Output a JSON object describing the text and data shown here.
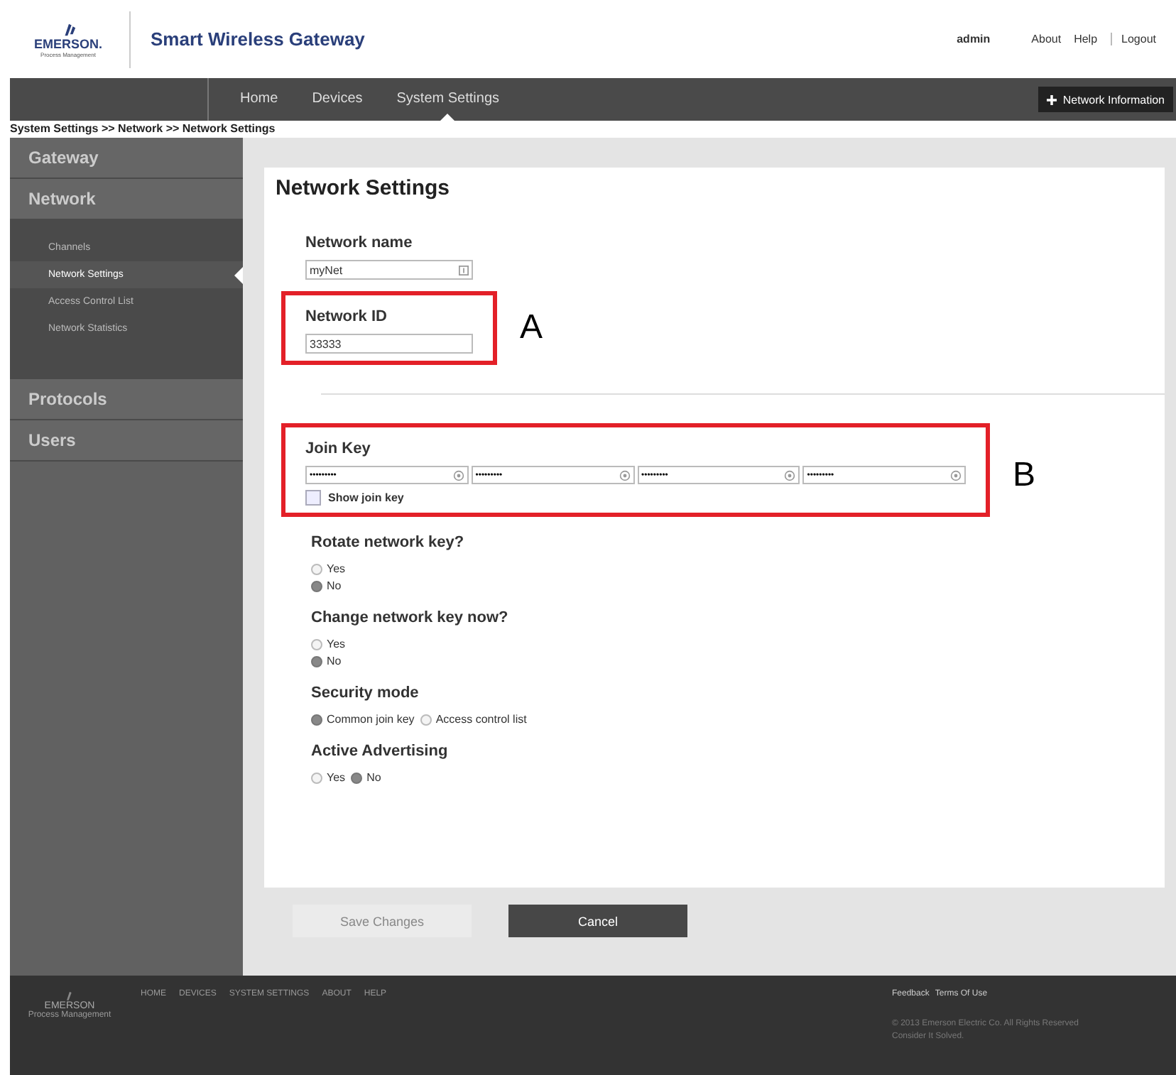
{
  "header": {
    "logo": {
      "name": "EMERSON.",
      "sub": "Process Management"
    },
    "title": "Smart Wireless Gateway",
    "user": "admin",
    "links": [
      "About",
      "Help",
      "Logout"
    ]
  },
  "nav": {
    "items": [
      {
        "label": "Home",
        "selected": false
      },
      {
        "label": "Devices",
        "selected": false
      },
      {
        "label": "System Settings",
        "selected": true
      }
    ],
    "action": "Network Information"
  },
  "breadcrumb": "System Settings >> Network >> Network Settings",
  "sidebar": [
    {
      "label": "Gateway"
    },
    {
      "label": "Network",
      "children": [
        {
          "label": "Channels",
          "selected": false
        },
        {
          "label": "Network Settings",
          "selected": true
        },
        {
          "label": "Access Control List",
          "selected": false
        },
        {
          "label": "Network Statistics",
          "selected": false
        }
      ]
    },
    {
      "label": "Protocols"
    },
    {
      "label": "Users"
    }
  ],
  "form": {
    "title": "Network Settings",
    "sections": [
      {
        "kind": "text",
        "label": "Network name",
        "value": "myNet",
        "info_icon": true
      },
      {
        "kind": "text",
        "label": "Network ID",
        "value": "33333",
        "info_icon": false,
        "annotation": "A"
      },
      {
        "kind": "divider"
      },
      {
        "kind": "keys",
        "label": "Join Key",
        "values": [
          "•••••••••",
          "•••••••••",
          "•••••••••",
          "•••••••••"
        ],
        "checkbox": {
          "label": "Show join key",
          "checked": false
        },
        "annotation": "B"
      },
      {
        "kind": "radio_stack",
        "label": "Rotate network key?",
        "options": [
          {
            "label": "Yes",
            "selected": false
          },
          {
            "label": "No",
            "selected": true
          }
        ]
      },
      {
        "kind": "radio_stack",
        "label": "Change network key now?",
        "options": [
          {
            "label": "Yes",
            "selected": false
          },
          {
            "label": "No",
            "selected": true
          }
        ]
      },
      {
        "kind": "radio_inline",
        "label": "Security mode",
        "options": [
          {
            "label": "Common join key",
            "selected": true
          },
          {
            "label": "Access control list",
            "selected": false
          }
        ]
      },
      {
        "kind": "radio_inline",
        "label": "Active Advertising",
        "options": [
          {
            "label": "Yes",
            "selected": false
          },
          {
            "label": "No",
            "selected": true
          }
        ]
      }
    ],
    "buttons": [
      {
        "label": "Save Changes",
        "disabled": true
      },
      {
        "label": "Cancel",
        "disabled": false
      }
    ]
  },
  "footer": {
    "logo": "EMERSON",
    "logo_sub": "Process Management",
    "links": [
      "HOME",
      "DEVICES",
      "SYSTEM SETTINGS",
      "ABOUT",
      "HELP"
    ],
    "right_links": [
      "Feedback",
      "Terms Of Use"
    ],
    "copyright": [
      "© 2013 Emerson Electric Co. All Rights Reserved",
      "Consider It Solved."
    ]
  }
}
